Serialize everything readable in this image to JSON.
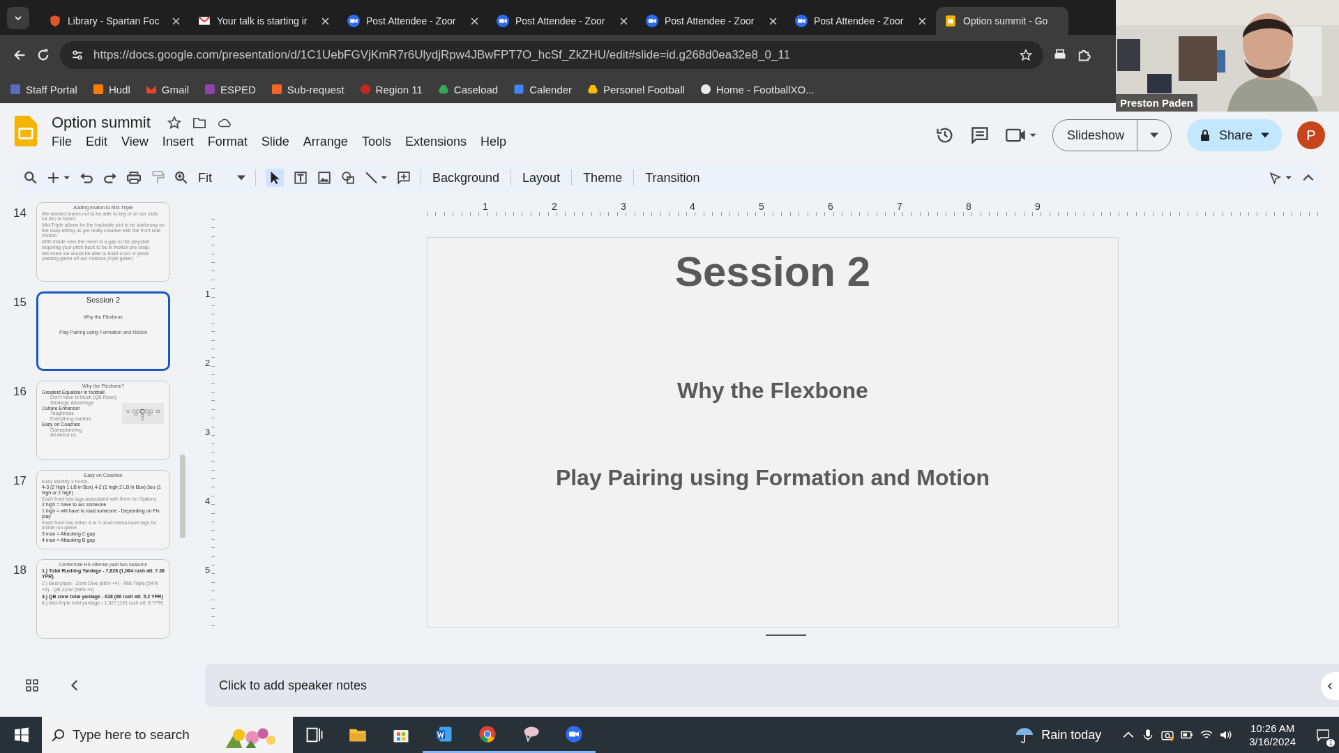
{
  "browser": {
    "tabs": [
      {
        "title": "Library - Spartan Foc",
        "selected": false
      },
      {
        "title": "Your talk is starting ir",
        "selected": false
      },
      {
        "title": "Post Attendee - Zoor",
        "selected": false
      },
      {
        "title": "Post Attendee - Zoor",
        "selected": false
      },
      {
        "title": "Post Attendee - Zoor",
        "selected": false
      },
      {
        "title": "Post Attendee - Zoor",
        "selected": false
      },
      {
        "title": "Option summit - Go",
        "selected": true
      }
    ],
    "url": "https://docs.google.com/presentation/d/1C1UebFGVjKmR7r6UlydjRpw4JBwFPT7O_hcSf_ZkZHU/edit#slide=id.g268d0ea32e8_0_11",
    "bookmarks": [
      {
        "label": "Staff Portal",
        "color": "#5c6bc0"
      },
      {
        "label": "Hudl",
        "color": "#ff7a00"
      },
      {
        "label": "Gmail",
        "color": "#ea4335"
      },
      {
        "label": "ESPED",
        "color": "#8e44ad"
      },
      {
        "label": "Sub-request",
        "color": "#f26522"
      },
      {
        "label": "Region 11",
        "color": "#c62828"
      },
      {
        "label": "Caseload",
        "color": "#34a853"
      },
      {
        "label": "Calender",
        "color": "#4285f4"
      },
      {
        "label": "Personel Football",
        "color": "#fbbc04"
      },
      {
        "label": "Home - FootballXO...",
        "color": "#e8eaed"
      }
    ]
  },
  "docs": {
    "title": "Option summit",
    "menu": [
      "File",
      "Edit",
      "View",
      "Insert",
      "Format",
      "Slide",
      "Arrange",
      "Tools",
      "Extensions",
      "Help"
    ],
    "slideshow": "Slideshow",
    "share": "Share",
    "avatar": "P",
    "zoom": "Fit",
    "toolbar_buttons": [
      "Background",
      "Layout",
      "Theme",
      "Transition"
    ]
  },
  "filmstrip": [
    {
      "number": "14",
      "selected": false,
      "kind": "bullets",
      "title": "Adding motion to Mid-Triple",
      "lines": [
        {
          "text": "We wanted teams not to be able to key in on our slots for Arc or Insert.",
          "emphasis": false
        },
        {
          "text": "Mid-Triple allows for the backside slot to be stationary on the snap letting us get really creative with the front side motion.",
          "emphasis": false
        },
        {
          "text": "With inside veer the mesh is a gap to the playside requiring your pitch back to be in motion pre-snap.",
          "emphasis": false
        },
        {
          "text": "We knew we would be able to build a ton of great passing game off our motions (Kyle geller)",
          "emphasis": false
        }
      ]
    },
    {
      "number": "15",
      "selected": true,
      "kind": "title",
      "title": "Session 2",
      "lines": [
        {
          "text": "Why the Flexbone"
        },
        {
          "text": "Play Pairing using Formation and Motion"
        }
      ]
    },
    {
      "number": "16",
      "selected": false,
      "kind": "diagram",
      "title": "Why the Flexbone?",
      "lines": [
        {
          "text": "Greatest Equalizer in football",
          "children": [
            {
              "text": "Don't have to block (QB Read)"
            },
            {
              "text": "Strategic Advantage"
            }
          ]
        },
        {
          "text": "Culture Enhancer",
          "children": [
            {
              "text": "Toughness"
            },
            {
              "text": "Everything matters"
            }
          ]
        },
        {
          "text": "Easy on Coaches",
          "children": [
            {
              "text": "Gameplanning"
            },
            {
              "text": "All About us"
            }
          ]
        }
      ]
    },
    {
      "number": "17",
      "selected": false,
      "kind": "bullets",
      "title": "Easy on Coaches",
      "lines": [
        {
          "text": "Easy identify 3 fronts.",
          "emphasis": false
        },
        {
          "text": "4-3 (2 high 1 LB in Box) 4-2 (1 high 2 LB in Box) 3oo (1 high or 2 high)",
          "emphasis": true
        },
        {
          "text": "Each front has tags associated with them for Options.",
          "emphasis": false
        },
        {
          "text": "2 high = have to arc someone",
          "emphasis": true
        },
        {
          "text": "1 high = will have to load someone - Depending on Fix play",
          "emphasis": true
        },
        {
          "text": "Each front has either 4 or 3 down mesa have tags for inside run game",
          "emphasis": false
        },
        {
          "text": "3 man = Attacking C gap",
          "emphasis": true
        },
        {
          "text": "4 man = Attacking B gap",
          "emphasis": true
        }
      ]
    },
    {
      "number": "18",
      "selected": false,
      "kind": "numbered",
      "title": "Centennial HS offense past two seasons",
      "lines": [
        {
          "text": "1.) Total Rushing Yardage - 7,828 (1,064 rush att. 7.38 YPR)",
          "emphasis": true
        },
        {
          "text": "2.) Best plays - Zone Dive (66% +4) - Mid-Triple (54% +4) - QB Zone (58% +4)",
          "emphasis": false
        },
        {
          "text": "3.) QB zone total yardage - 628 (88 rush att. 5.2 YPR)",
          "emphasis": true
        },
        {
          "text": "4.) Mid-Triple total yardage - 1,527 (191 rush att. 8 YPR)",
          "emphasis": false
        }
      ]
    }
  ],
  "ruler": {
    "horizontal": [
      "1",
      "2",
      "3",
      "4",
      "5",
      "6",
      "7",
      "8",
      "9"
    ],
    "vertical": [
      "1",
      "2",
      "3",
      "4",
      "5"
    ]
  },
  "slide": {
    "title": "Session 2",
    "lines": [
      "Why the Flexbone",
      "Play Pairing using Formation and Motion"
    ]
  },
  "notes": {
    "placeholder": "Click to add speaker notes"
  },
  "webcam": {
    "name": "Preston Paden"
  },
  "taskbar": {
    "search": {
      "placeholder": "Type here to search"
    },
    "apps": [
      {
        "active": false
      },
      {
        "active": false
      },
      {
        "active": false
      },
      {
        "active": true
      },
      {
        "active": true
      },
      {
        "active": true
      },
      {
        "active": true
      }
    ],
    "weather": "Rain today",
    "time": "10:26 AM",
    "date": "3/16/2024",
    "notifications": "1"
  }
}
